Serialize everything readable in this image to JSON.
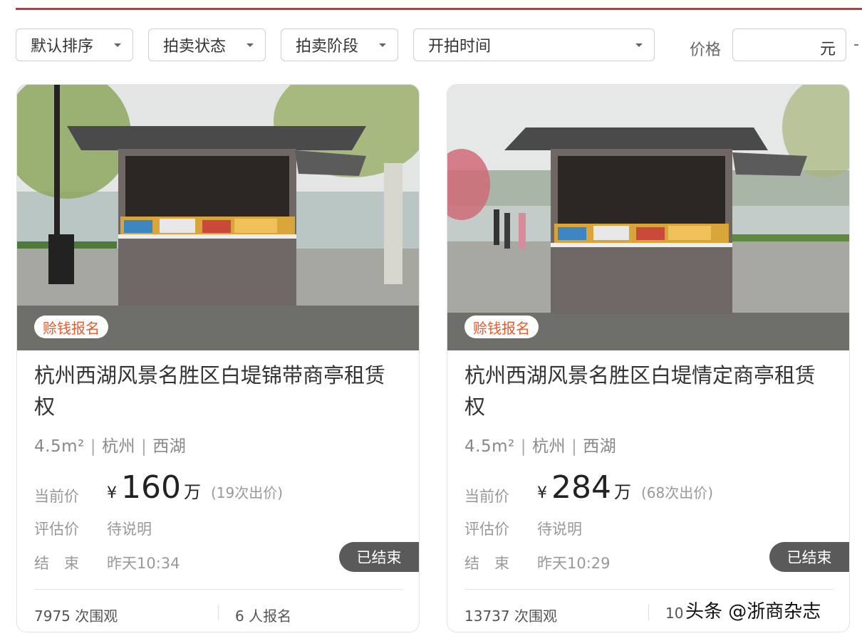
{
  "filters": {
    "sort": "默认排序",
    "auction_status": "拍卖状态",
    "auction_stage": "拍卖阶段",
    "start_time": "开拍时间",
    "price_label": "价格",
    "price_unit": "元",
    "price_dash": "-"
  },
  "cards": [
    {
      "tag": "赊钱报名",
      "title": "杭州西湖风景名胜区白堤锦带商亭租赁权",
      "area": "4.5m²",
      "city": "杭州",
      "district": "西湖",
      "current_price_label": "当前价",
      "currency": "¥",
      "price": "160",
      "price_unit": "万",
      "bids": "(19次出价)",
      "estimate_label": "评估价",
      "estimate_value": "待说明",
      "end_label": "结　束",
      "end_value": "昨天10:34",
      "status": "已结束",
      "views": "7975 次围观",
      "signups": "6 人报名"
    },
    {
      "tag": "赊钱报名",
      "title": "杭州西湖风景名胜区白堤情定商亭租赁权",
      "area": "4.5m²",
      "city": "杭州",
      "district": "西湖",
      "current_price_label": "当前价",
      "currency": "¥",
      "price": "284",
      "price_unit": "万",
      "bids": "(68次出价)",
      "estimate_label": "评估价",
      "estimate_value": "待说明",
      "end_label": "结　束",
      "end_value": "昨天10:29",
      "status": "已结束",
      "views": "13737 次围观",
      "signups": "10"
    }
  ],
  "watermark": "头条 @浙商杂志",
  "colors": {
    "accent_line": "#d1313e",
    "tag_text": "#ea5a2a",
    "status_bg": "#5a5a5a"
  }
}
